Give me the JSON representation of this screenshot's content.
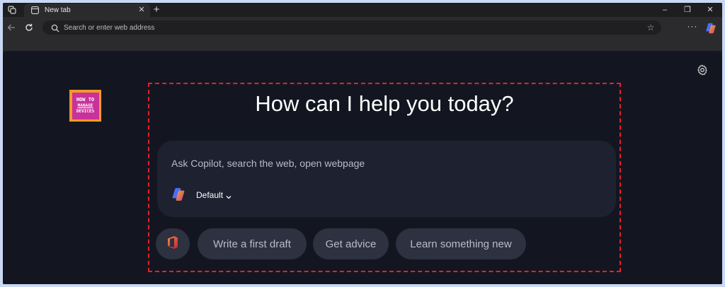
{
  "browser": {
    "tab": {
      "title": "New tab"
    },
    "newtab_symbol": "+",
    "window_controls": {
      "minimize": "–",
      "restore": "❐",
      "close": "✕"
    },
    "omnibox": {
      "placeholder": "Search or enter web address",
      "value": ""
    },
    "more_symbol": "···"
  },
  "page": {
    "headline": "How can I help you today?",
    "logo": {
      "line1": "HOW TO",
      "line2": "MANAGE",
      "line3": "DEVICES",
      "colors": {
        "outer": "#f39a2a",
        "inner": "#c8329a"
      }
    },
    "composer": {
      "placeholder": "Ask Copilot, search the web, open webpage",
      "mode": "Default"
    },
    "suggestions": [
      {
        "label": "Write a first draft"
      },
      {
        "label": "Get advice"
      },
      {
        "label": "Learn something new"
      }
    ]
  },
  "colors": {
    "page_bg": "#131620",
    "composer_bg": "#1d2130",
    "chip_bg": "#2d3140",
    "highlight_border": "#e4202a",
    "frame_bg": "#c9d9f4"
  },
  "icons": {
    "workspaces": "workspaces-icon",
    "tab": "new-tab-page-icon",
    "back": "back-arrow-icon",
    "refresh": "refresh-icon",
    "search": "search-icon",
    "favorite": "star-icon",
    "copilot": "copilot-icon",
    "settings": "gear-icon",
    "office": "office-icon"
  }
}
